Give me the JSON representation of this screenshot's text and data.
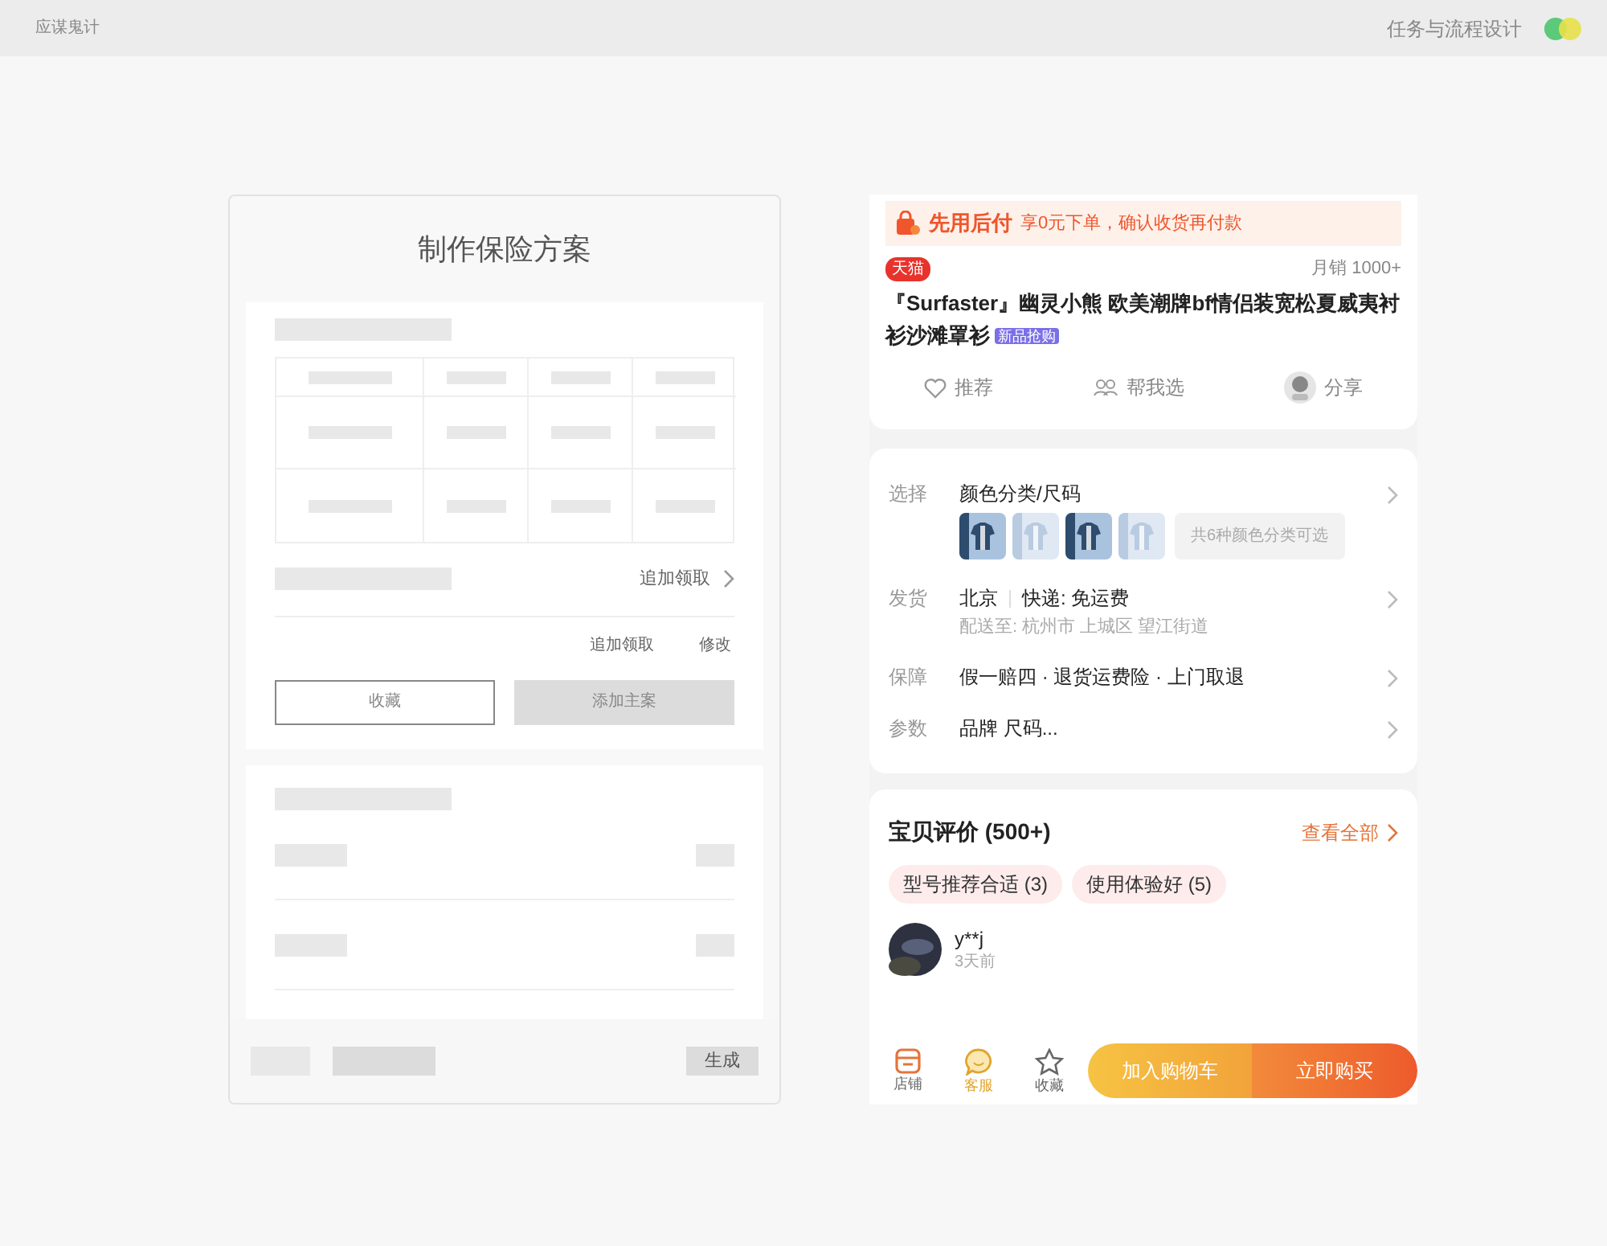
{
  "top_bar": {
    "app_name": "应谋鬼计",
    "section": "任务与流程设计"
  },
  "plan_panel": {
    "title": "制作保险方案",
    "more_link": "追加领取",
    "actions": [
      {
        "label": "追加领取"
      },
      {
        "label": "修改"
      }
    ],
    "buttons": [
      {
        "label": "收藏",
        "kind": "outline"
      },
      {
        "label": "添加主案",
        "kind": "filled"
      }
    ],
    "footer_button": "生成"
  },
  "product": {
    "pay_later": {
      "title": "先用后付",
      "text": "享0元下单，确认收货再付款"
    },
    "store_badge": "天猫",
    "sales": "月销 1000+",
    "title": "『Surfaster』幽灵小熊 欧美潮牌bf情侣装宽松夏威夷衬衫沙滩罩衫",
    "tag": "新品抢购",
    "actions": [
      {
        "label": "推荐",
        "kind": "heart"
      },
      {
        "label": "帮我选",
        "kind": "people"
      },
      {
        "label": "分享",
        "kind": "avatar"
      }
    ],
    "specs": [
      {
        "label": "选择",
        "value": "颜色分类/尺码",
        "kind": "variants",
        "note": "共6种颜色分类可选"
      },
      {
        "label": "发货",
        "value": "北京",
        "extra": "快递: 免运费",
        "sub": "配送至: 杭州市 上城区 望江街道",
        "kind": "shipping"
      },
      {
        "label": "保障",
        "value": "假一赔四 · 退货运费险 · 上门取退",
        "kind": "text"
      },
      {
        "label": "参数",
        "value": "品牌 尺码...",
        "kind": "text"
      }
    ],
    "reviews": {
      "title": "宝贝评价 (500+)",
      "see_all": "查看全部",
      "tags": [
        "型号推荐合适 (3)",
        "使用体验好 (5)"
      ],
      "user": "y**j",
      "time": "3天前"
    },
    "bottom_bar": {
      "icons": [
        {
          "label": "店铺",
          "kind": "store"
        },
        {
          "label": "客服",
          "kind": "chat"
        },
        {
          "label": "收藏",
          "kind": "star"
        }
      ],
      "cart": "加入购物车",
      "buy": "立即购买"
    }
  }
}
